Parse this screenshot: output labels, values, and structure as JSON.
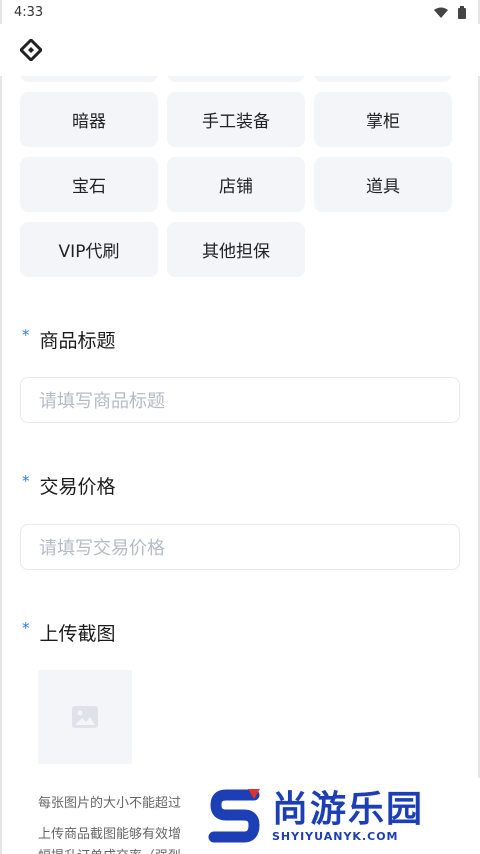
{
  "status_bar": {
    "time": "4:33",
    "icons": [
      "wifi-icon",
      "battery-icon"
    ]
  },
  "app_bar": {
    "logo_icon": "app-logo-icon"
  },
  "categories": {
    "rows": [
      [
        "暗器",
        "手工装备",
        "掌柜"
      ],
      [
        "宝石",
        "店铺",
        "道具"
      ],
      [
        "VIP代刷",
        "其他担保"
      ]
    ]
  },
  "form": {
    "title_field": {
      "label": "商品标题",
      "required_mark": "*",
      "placeholder": "请填写商品标题"
    },
    "price_field": {
      "label": "交易价格",
      "required_mark": "*",
      "placeholder": "请填写交易价格"
    },
    "upload_field": {
      "label": "上传截图",
      "required_mark": "*",
      "hint_line1": "每张图片的大小不能超过",
      "hint_line2": "上传商品截图能够有效增",
      "hint_line3": "幅提升订单成交率（强烈"
    }
  },
  "watermark": {
    "cn": "尚游乐园",
    "en": "SHYIYUANYK.COM"
  },
  "colors": {
    "accent": "#2c7be5",
    "chip_bg": "#f3f5f8",
    "placeholder": "#b5bbc4",
    "watermark": "#1d3fb5"
  }
}
